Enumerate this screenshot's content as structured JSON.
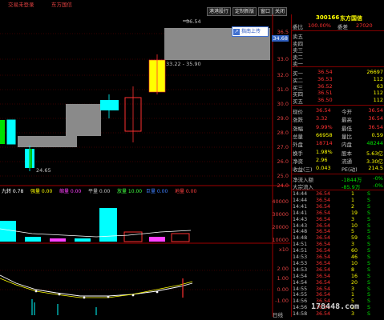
{
  "window": {
    "menu_left": "交易未登录",
    "menu_mid": "东方国信",
    "btn1": "港港股行",
    "btn2": "定制新版",
    "btn3": "窗口",
    "btn4": "关闭"
  },
  "header": {
    "code": "300166",
    "name": "东方国信",
    "ratio_label": "委比",
    "ratio_value": "100.00%",
    "diff_label": "委差",
    "diff_value": "27020"
  },
  "popup": {
    "label": "指南上传"
  },
  "chart": {
    "price_labels": [
      "36.5",
      "34.6",
      "33.0",
      "32.0",
      "31.0",
      "30.0",
      "29.0",
      "28.0",
      "27.0",
      "26.0",
      "25.0",
      "24.0"
    ],
    "cur_price": "34.68",
    "annot_top": "36.54",
    "annot_range": "33.22 - 35.90",
    "annot_low": "24.65",
    "indicator_bar": {
      "items": [
        {
          "text": "九转 0.78",
          "color": "#ffffff"
        },
        {
          "text": "强量 0.00",
          "color": "#ffff00"
        },
        {
          "text": "缩量 0.00",
          "color": "#ff40ff"
        },
        {
          "text": "平量 0.00",
          "color": "#c0c0c0"
        },
        {
          "text": "放量 10.00",
          "color": "#40ff40"
        },
        {
          "text": "巨量 0.00",
          "color": "#4080ff"
        },
        {
          "text": "地量 0.00",
          "color": "#ff4040"
        }
      ]
    },
    "vol_labels": [
      "40000",
      "30000",
      "20000",
      "10000",
      "x10"
    ],
    "macd_labels": [
      "2.00",
      "1.00",
      "0.00",
      "-1.00"
    ],
    "bottom_label": "日线"
  },
  "quotes": {
    "sells": [
      {
        "label": "卖五",
        "price": "",
        "vol": ""
      },
      {
        "label": "卖四",
        "price": "",
        "vol": ""
      },
      {
        "label": "卖三",
        "price": "",
        "vol": ""
      },
      {
        "label": "卖二",
        "price": "",
        "vol": ""
      },
      {
        "label": "卖一",
        "price": "",
        "vol": ""
      }
    ],
    "buys": [
      {
        "label": "买一",
        "price": "36.54",
        "vol": "26697"
      },
      {
        "label": "买二",
        "price": "36.53",
        "vol": "112"
      },
      {
        "label": "买三",
        "price": "36.52",
        "vol": "63"
      },
      {
        "label": "买四",
        "price": "36.51",
        "vol": "112"
      },
      {
        "label": "买五",
        "price": "36.50",
        "vol": "112"
      }
    ]
  },
  "stats": [
    {
      "l1": "现价",
      "v1": "36.54",
      "l2": "今开",
      "v2": "36.54"
    },
    {
      "l1": "涨跌",
      "v1": "3.32",
      "l2": "最高",
      "v2": "36.54"
    },
    {
      "l1": "涨幅",
      "v1": "9.99%",
      "l2": "最低",
      "v2": "36.54"
    },
    {
      "l1": "总量",
      "v1": "66958",
      "l2": "量比",
      "v2": "0.59"
    },
    {
      "l1": "外盘",
      "v1": "18714",
      "l2": "内盘",
      "v2": "48244"
    },
    {
      "l1": "换手",
      "v1": "1.98%",
      "l2": "股本",
      "v2": "5.63亿"
    },
    {
      "l1": "净资",
      "v1": "2.96",
      "l2": "流通",
      "v2": "3.30亿"
    },
    {
      "l1": "收益(三)",
      "v1": "0.043",
      "l2": "PE(动)",
      "v2": "214.5"
    }
  ],
  "flows": [
    {
      "label": "净流入额",
      "value": "-1844万",
      "pct": "-0%"
    },
    {
      "label": "大宗流入",
      "value": "-85.9万",
      "pct": "-0%"
    }
  ],
  "ticks": [
    {
      "time": "14:44",
      "price": "36.54",
      "vol": "1",
      "bs": "S"
    },
    {
      "time": "14:44",
      "price": "36.54",
      "vol": "1",
      "bs": "S"
    },
    {
      "time": "14:41",
      "price": "36.54",
      "vol": "2",
      "bs": "S"
    },
    {
      "time": "14:41",
      "price": "36.54",
      "vol": "19",
      "bs": "S"
    },
    {
      "time": "14:43",
      "price": "36.54",
      "vol": "3",
      "bs": "S"
    },
    {
      "time": "14:43",
      "price": "36.54",
      "vol": "10",
      "bs": "S"
    },
    {
      "time": "14:48",
      "price": "36.54",
      "vol": "5",
      "bs": "S"
    },
    {
      "time": "14:48",
      "price": "36.54",
      "vol": "59",
      "bs": "S"
    },
    {
      "time": "14:51",
      "price": "36.54",
      "vol": "3",
      "bs": "S"
    },
    {
      "time": "14:51",
      "price": "36.54",
      "vol": "60",
      "bs": "S"
    },
    {
      "time": "14:53",
      "price": "36.54",
      "vol": "46",
      "bs": "S"
    },
    {
      "time": "14:53",
      "price": "36.54",
      "vol": "10",
      "bs": "S"
    },
    {
      "time": "14:53",
      "price": "36.54",
      "vol": "8",
      "bs": "S"
    },
    {
      "time": "14:54",
      "price": "36.54",
      "vol": "16",
      "bs": "S"
    },
    {
      "time": "14:54",
      "price": "36.54",
      "vol": "20",
      "bs": "S"
    },
    {
      "time": "14:55",
      "price": "36.54",
      "vol": "3",
      "bs": "S"
    },
    {
      "time": "14:55",
      "price": "36.54",
      "vol": "1",
      "bs": "S"
    },
    {
      "time": "14:56",
      "price": "36.54",
      "vol": "5",
      "bs": "S"
    },
    {
      "time": "14:56",
      "price": "36.54",
      "vol": "2",
      "bs": "S"
    },
    {
      "time": "14:58",
      "price": "36.54",
      "vol": "3",
      "bs": "S"
    }
  ],
  "watermark": "178448.com"
}
